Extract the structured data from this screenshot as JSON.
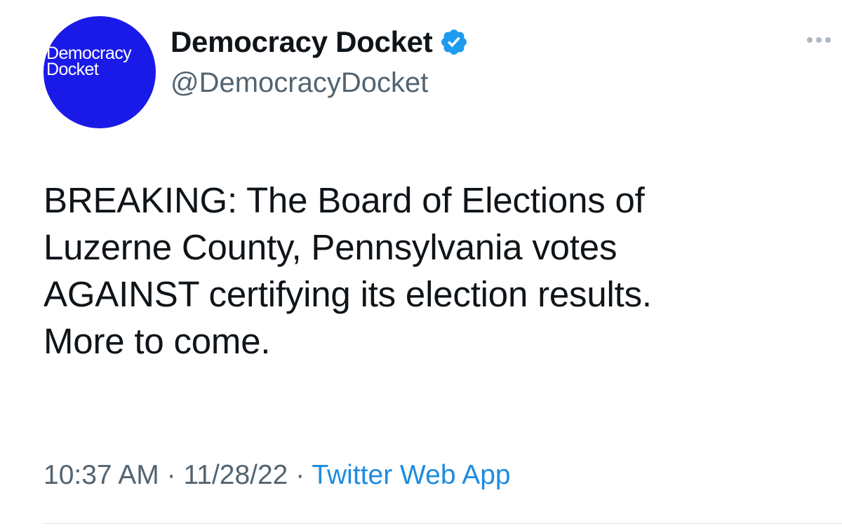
{
  "author": {
    "avatar_text": "Democracy\nDocket",
    "display_name": "Democracy Docket",
    "handle": "@DemocracyDocket",
    "verified_icon": "verified-badge-icon",
    "avatar_color": "#1a1ae8",
    "verified_color": "#1d9bf0"
  },
  "menu": {
    "icon": "more-options-icon"
  },
  "tweet": {
    "lines": [
      "BREAKING: The Board of Elections of",
      "Luzerne County, Pennsylvania votes",
      "AGAINST certifying its election results.",
      "More to come."
    ]
  },
  "meta": {
    "time": "10:37 AM",
    "separator1": " · ",
    "date": "11/28/22",
    "separator2": " · ",
    "source": "Twitter Web App",
    "source_color": "#1d8ce0"
  }
}
